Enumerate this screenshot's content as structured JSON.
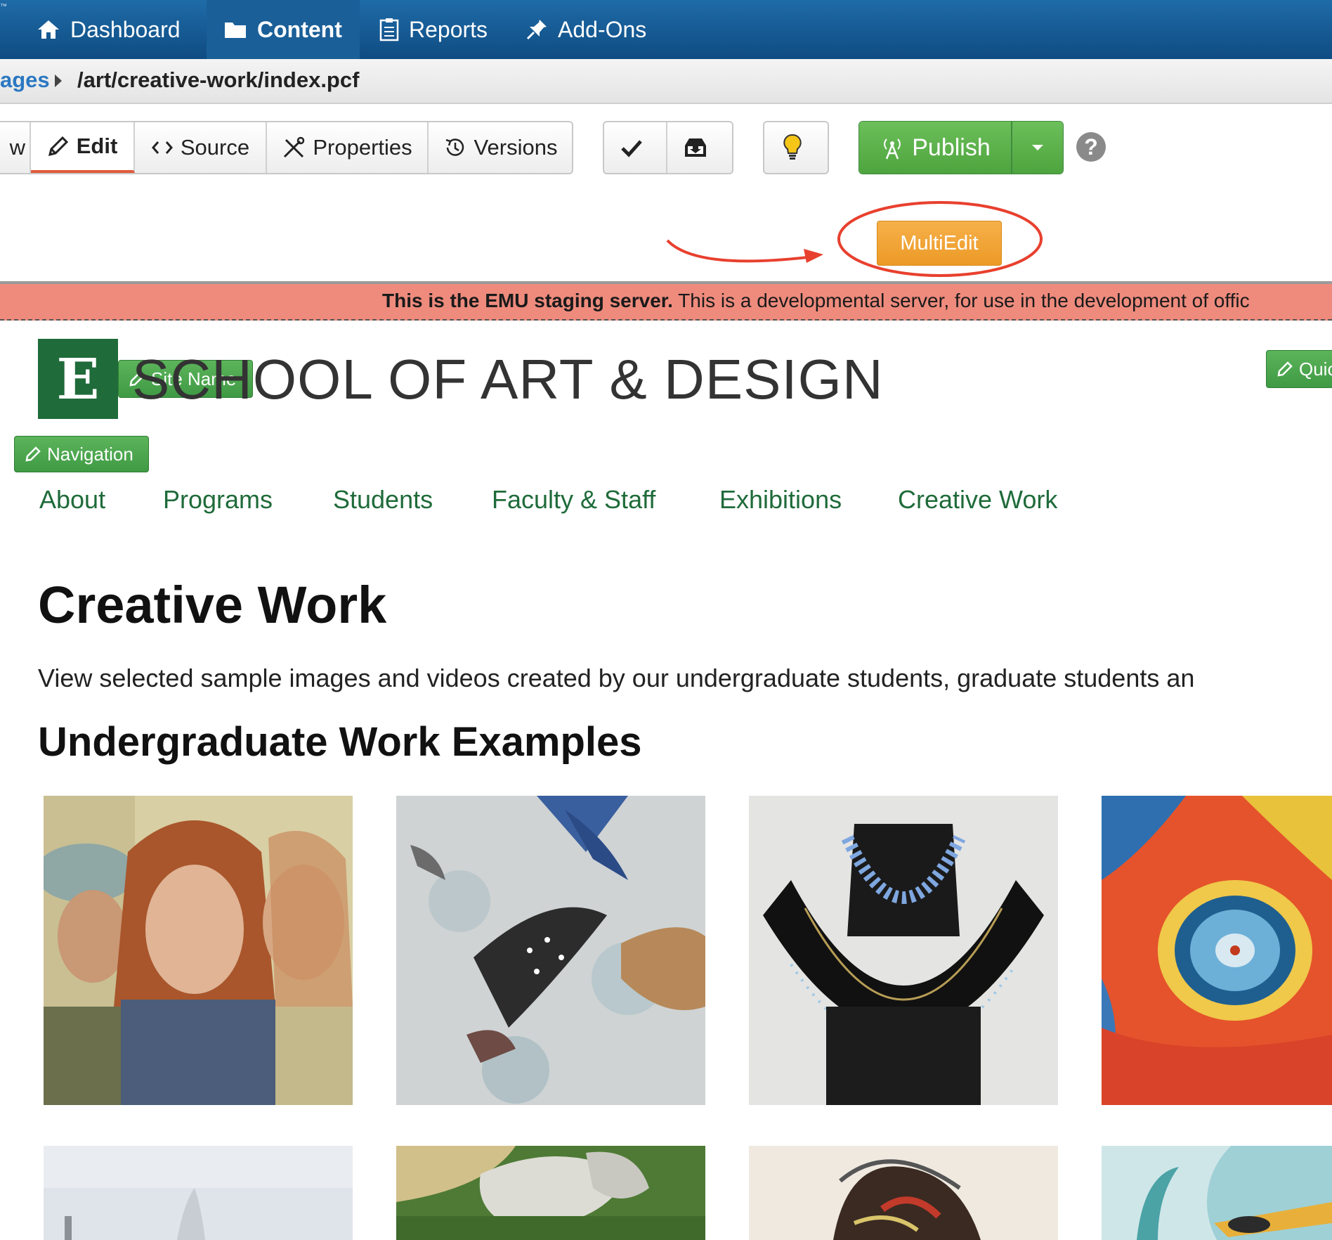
{
  "topnav": {
    "trademark": "™",
    "dashboard": "Dashboard",
    "content": "Content",
    "reports": "Reports",
    "addons": "Add-Ons"
  },
  "breadcrumb": {
    "link": "ages",
    "path": "/art/creative-work/index.pcf"
  },
  "toolbar": {
    "preview_fragment": "w",
    "edit": "Edit",
    "source": "Source",
    "properties": "Properties",
    "versions": "Versions",
    "publish": "Publish"
  },
  "multiedit": "MultiEdit",
  "staging": {
    "bold": "This is the EMU staging server.",
    "rest": " This is a developmental server, for use in the development of offic"
  },
  "site": {
    "logo_letter": "E",
    "site_name_button": "Site Name",
    "title": "SCHOOL OF ART & DESIGN",
    "quick_button": "Quic",
    "navigation_button": "Navigation",
    "nav": [
      "About",
      "Programs",
      "Students",
      "Faculty & Staff",
      "Exhibitions",
      "Creative Work"
    ]
  },
  "content": {
    "heading": "Creative Work",
    "intro": "View selected sample images and videos created by our undergraduate students, graduate students an",
    "subheading": "Undergraduate Work Examples"
  },
  "colors": {
    "topbar": "#1565a3",
    "publish_green": "#5cb14c",
    "multiedit_orange": "#f0a23a",
    "annotation_red": "#e8402e",
    "staging_banner": "#ee8b7d",
    "brand_green": "#1f6b3a"
  }
}
